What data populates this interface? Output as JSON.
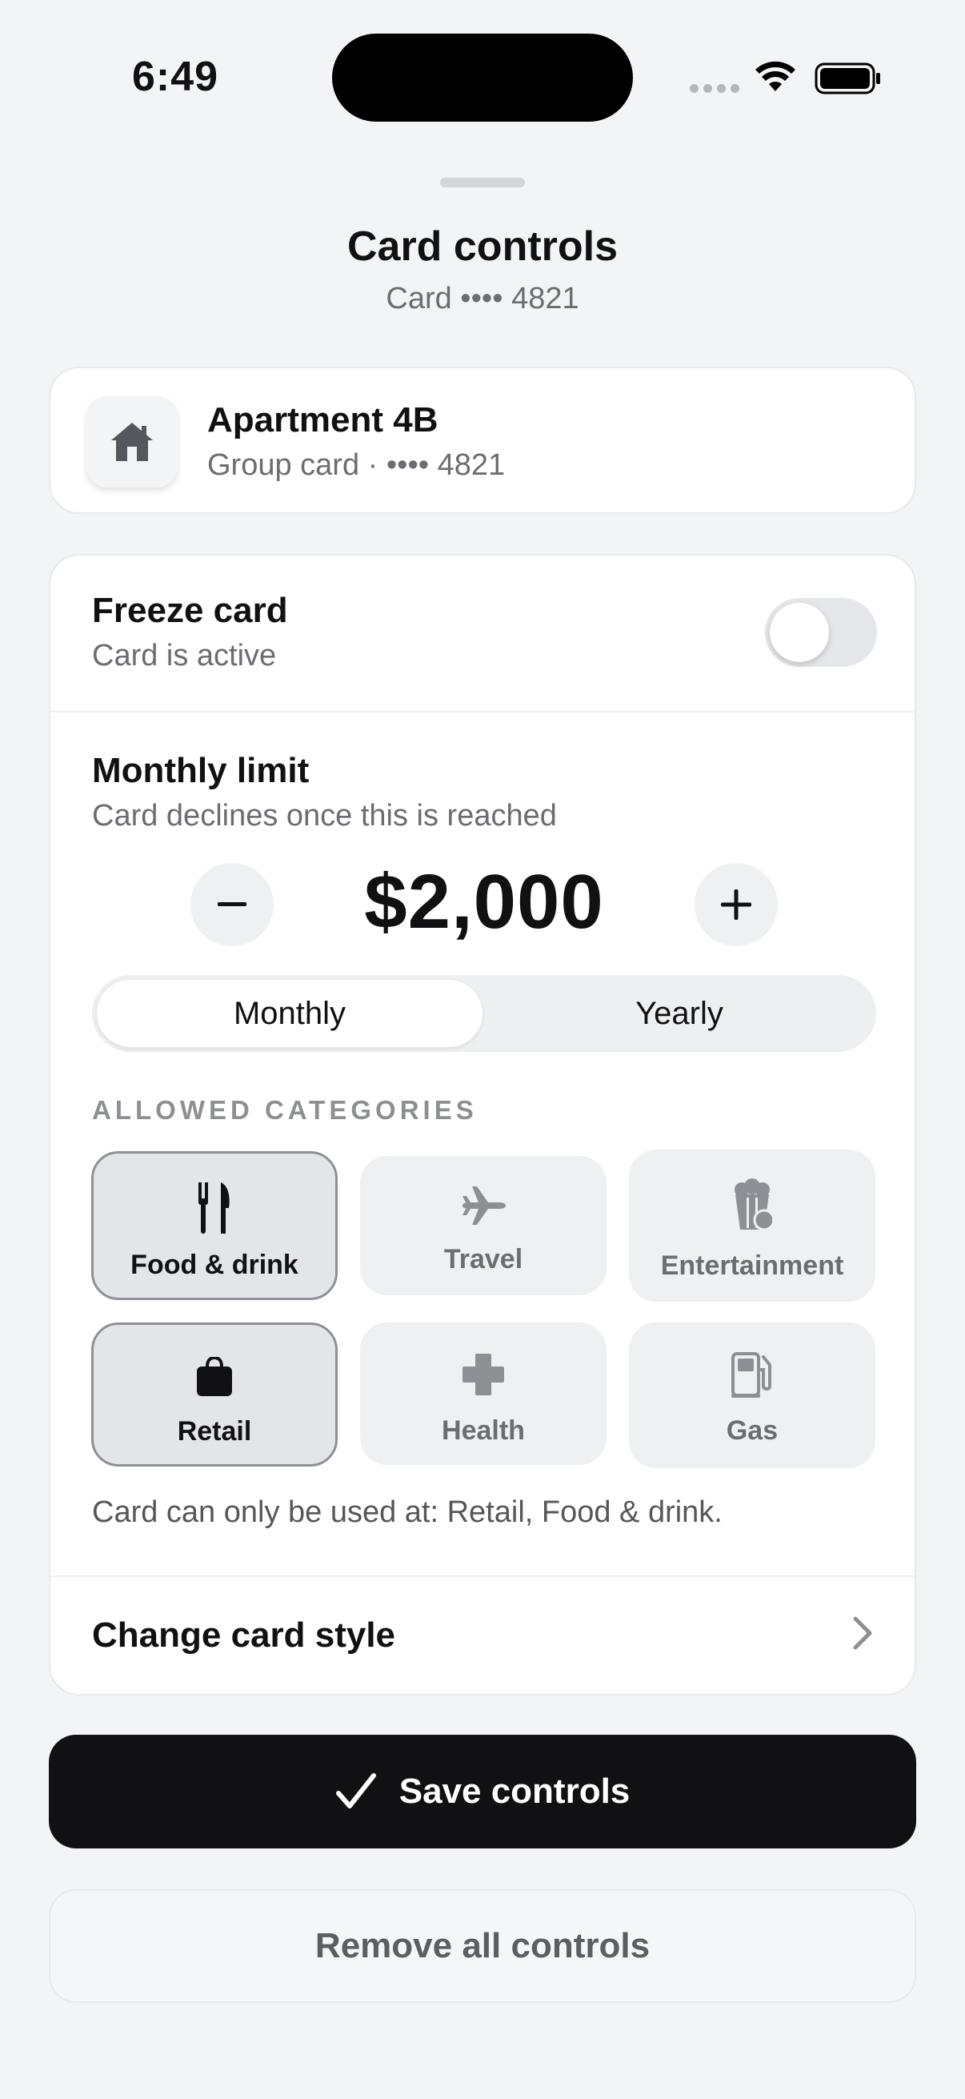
{
  "status_bar": {
    "time": "6:49"
  },
  "sheet": {
    "title": "Card controls",
    "subtitle": "Card •••• 4821"
  },
  "account": {
    "name": "Apartment 4B",
    "meta": "Group card · •••• 4821",
    "icon": "house-icon"
  },
  "freeze": {
    "title": "Freeze card",
    "status": "Card is active",
    "enabled": false
  },
  "limit": {
    "title": "Monthly limit",
    "description": "Card declines once this is reached",
    "amount": "$2,000",
    "decrease_symbol": "−",
    "increase_symbol": "+"
  },
  "period": {
    "options": [
      "Monthly",
      "Yearly"
    ],
    "selected": "Monthly"
  },
  "categories": {
    "label": "ALLOWED CATEGORIES",
    "items": [
      {
        "label": "Food & drink",
        "icon": "fork-knife-icon",
        "selected": true
      },
      {
        "label": "Travel",
        "icon": "airplane-icon",
        "selected": false
      },
      {
        "label": "Entertainment",
        "icon": "popcorn-icon",
        "selected": false
      },
      {
        "label": "Retail",
        "icon": "shopping-bag-icon",
        "selected": true
      },
      {
        "label": "Health",
        "icon": "cross-icon",
        "selected": false
      },
      {
        "label": "Gas",
        "icon": "fuel-pump-icon",
        "selected": false
      }
    ],
    "note": "Card can only be used at: Retail, Food & drink."
  },
  "style_row": {
    "label": "Change card style"
  },
  "actions": {
    "save": "Save controls",
    "remove": "Remove all controls"
  },
  "colors": {
    "primary": "#111113",
    "background": "#f3f4f6",
    "muted": "#6b6d73"
  }
}
